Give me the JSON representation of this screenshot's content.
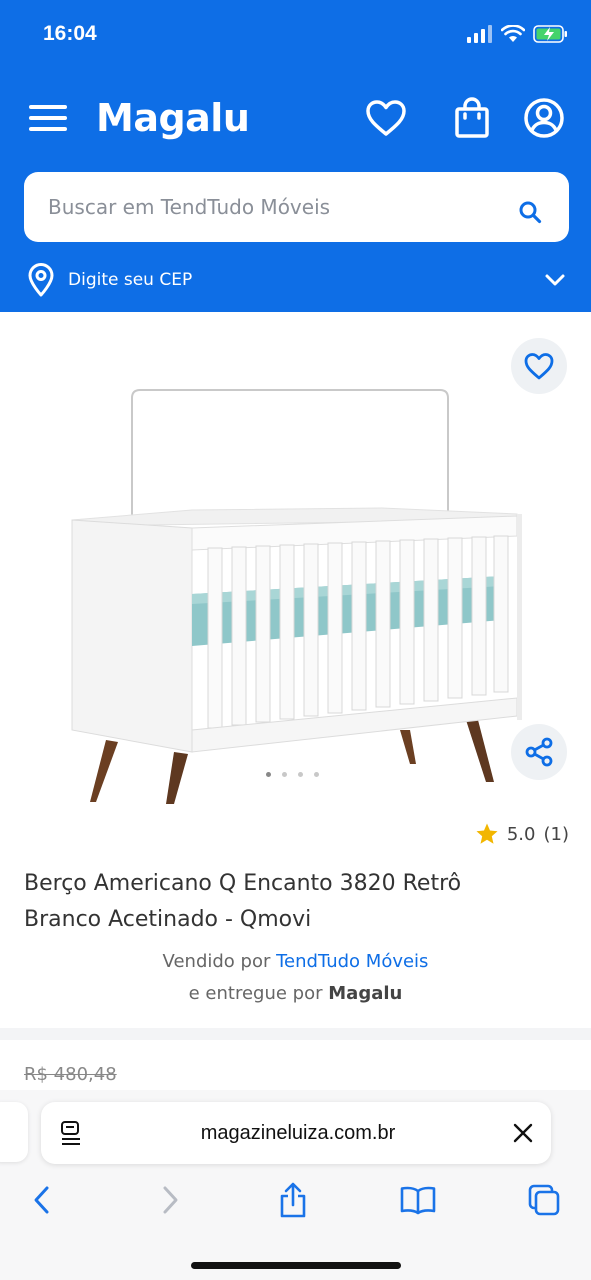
{
  "status_bar": {
    "time": "16:04"
  },
  "header": {
    "logo": "Magalu",
    "search_placeholder": "Buscar em TendTudo Móveis",
    "cep_label": "Digite seu CEP"
  },
  "product": {
    "image_dots_total": 4,
    "image_dot_active": 1,
    "rating_value": "5.0",
    "rating_count": "(1)",
    "title_line1": "Berço Americano Q Encanto 3820 Retrô",
    "title_line2": "Branco Acetinado - Qmovi",
    "sold_by_prefix": "Vendido por",
    "seller_name": "TendTudo Móveis",
    "delivered_prefix": "e entregue por",
    "delivery_name": "Magalu",
    "old_price": "R$ 480,48"
  },
  "browser": {
    "url": "magazineluiza.com.br"
  },
  "colors": {
    "brand_blue": "#0e6ee6",
    "star": "#f2b600"
  }
}
